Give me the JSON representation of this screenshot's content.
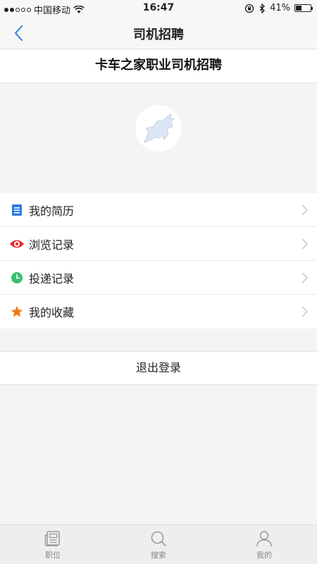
{
  "status_bar": {
    "carrier": "中国移动",
    "time": "16:47",
    "battery": "41%",
    "battery_level": 0.41
  },
  "nav": {
    "title": "司机招聘",
    "back_icon": "chevron-left-icon"
  },
  "header": {
    "title": "卡车之家职业司机招聘"
  },
  "menu": {
    "items": [
      {
        "label": "我的简历",
        "icon": "resume-icon",
        "color": "#2b7be4"
      },
      {
        "label": "浏览记录",
        "icon": "eye-icon",
        "color": "#e02f2f"
      },
      {
        "label": "投递记录",
        "icon": "clock-icon",
        "color": "#34c26b"
      },
      {
        "label": "我的收藏",
        "icon": "star-icon",
        "color": "#f07a12"
      }
    ]
  },
  "logout": {
    "label": "退出登录"
  },
  "tabs": [
    {
      "label": "职位",
      "icon": "newspaper-icon"
    },
    {
      "label": "搜索",
      "icon": "search-icon"
    },
    {
      "label": "我的",
      "icon": "person-icon"
    }
  ],
  "colors": {
    "accent": "#2f7de1",
    "background": "#f4f4f4"
  }
}
